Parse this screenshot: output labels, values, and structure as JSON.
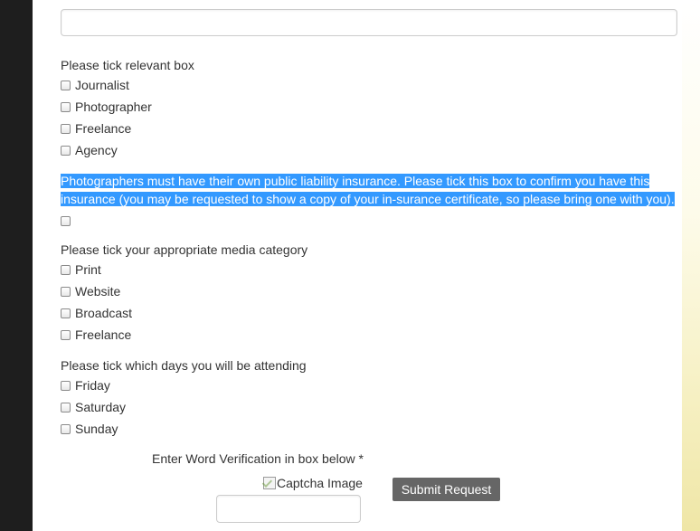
{
  "form": {
    "top_input": {
      "value": "",
      "placeholder": ""
    },
    "role_group": {
      "label": "Please tick relevant box",
      "options": [
        "Journalist",
        "Photographer",
        "Freelance",
        "Agency"
      ]
    },
    "insurance_notice": {
      "text": "Photographers must have their own public liability insurance. Please tick this box to confirm you have this insurance (you may be requested to show a copy of your in-surance certificate, so please bring one with you).",
      "checked": false
    },
    "media_group": {
      "label": "Please tick your appropriate media category",
      "options": [
        "Print",
        "Website",
        "Broadcast",
        "Freelance"
      ]
    },
    "days_group": {
      "label": "Please tick which days you will be attending",
      "options": [
        "Friday",
        "Saturday",
        "Sunday"
      ]
    },
    "verification": {
      "label": "Enter Word Verification in box below *",
      "captcha_alt": "Captcha Image",
      "input_value": ""
    },
    "submit_label": "Submit Request"
  },
  "colors": {
    "selection_highlight": "#3399ff",
    "submit_button": "#666666",
    "sidebar": "#1e1e1e"
  },
  "icons": {
    "checkbox": "checkbox-unchecked",
    "captcha": "broken-image-icon"
  }
}
